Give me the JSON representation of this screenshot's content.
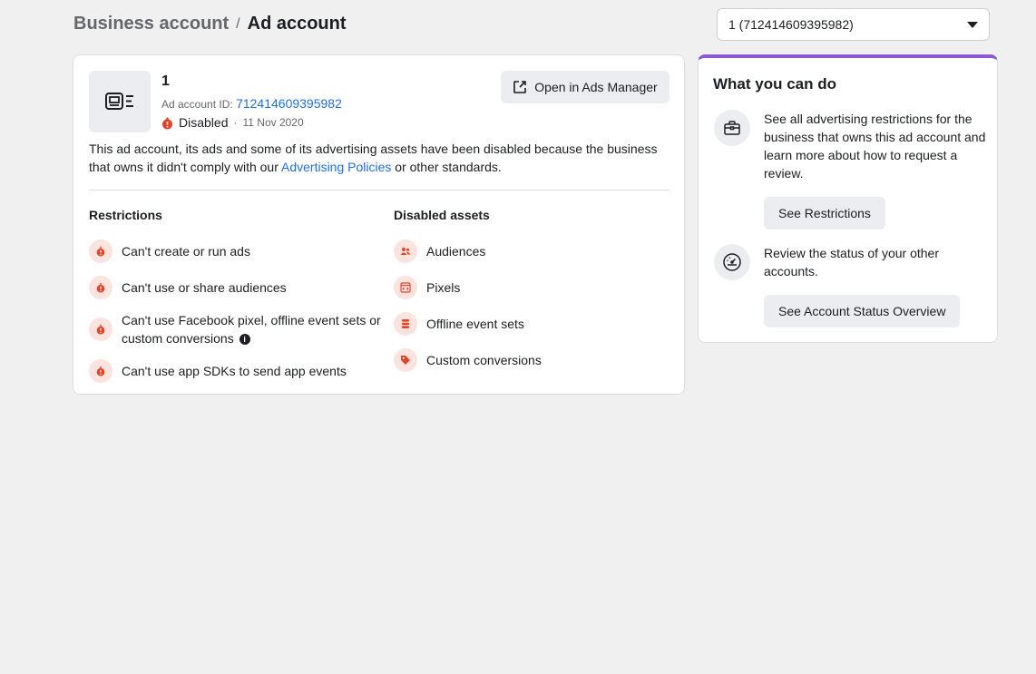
{
  "breadcrumb": {
    "parent": "Business account",
    "separator": "/",
    "current": "Ad account"
  },
  "account_select": {
    "value": "1 (712414609395982)"
  },
  "account": {
    "name": "1",
    "id_label": "Ad account ID:",
    "id": "712414609395982",
    "status": "Disabled",
    "status_sep": "·",
    "date": "11 Nov 2020",
    "open_button": "Open in Ads Manager",
    "desc_before": "This ad account, its ads and some of its advertising assets have been disabled because the business that owns it didn't comply with our ",
    "desc_link": "Advertising Policies",
    "desc_after": " or other standards."
  },
  "restrictions": {
    "title": "Restrictions",
    "items": [
      {
        "label": "Can't create or run ads"
      },
      {
        "label": "Can't use or share audiences"
      },
      {
        "label": "Can't use Facebook pixel, offline event sets or custom conversions"
      },
      {
        "label": "Can't use app SDKs to send app events"
      }
    ]
  },
  "disabled_assets": {
    "title": "Disabled assets",
    "items": [
      {
        "label": "Audiences",
        "icon": "people-icon"
      },
      {
        "label": "Pixels",
        "icon": "code-icon"
      },
      {
        "label": "Offline event sets",
        "icon": "database-icon"
      },
      {
        "label": "Custom conversions",
        "icon": "tag-icon"
      }
    ]
  },
  "side": {
    "title": "What you can do",
    "item1_text": "See all advertising restrictions for the business that owns this ad account and learn more about how to request a review.",
    "item1_button": "See Restrictions",
    "item2_text": "Review the status of your other accounts.",
    "item2_button": "See Account Status Overview"
  },
  "colors": {
    "accent_purple": "#8b58d6",
    "link_blue": "#216fdb",
    "alert_red": "#e0452b",
    "alert_bg": "#fbe3df"
  }
}
